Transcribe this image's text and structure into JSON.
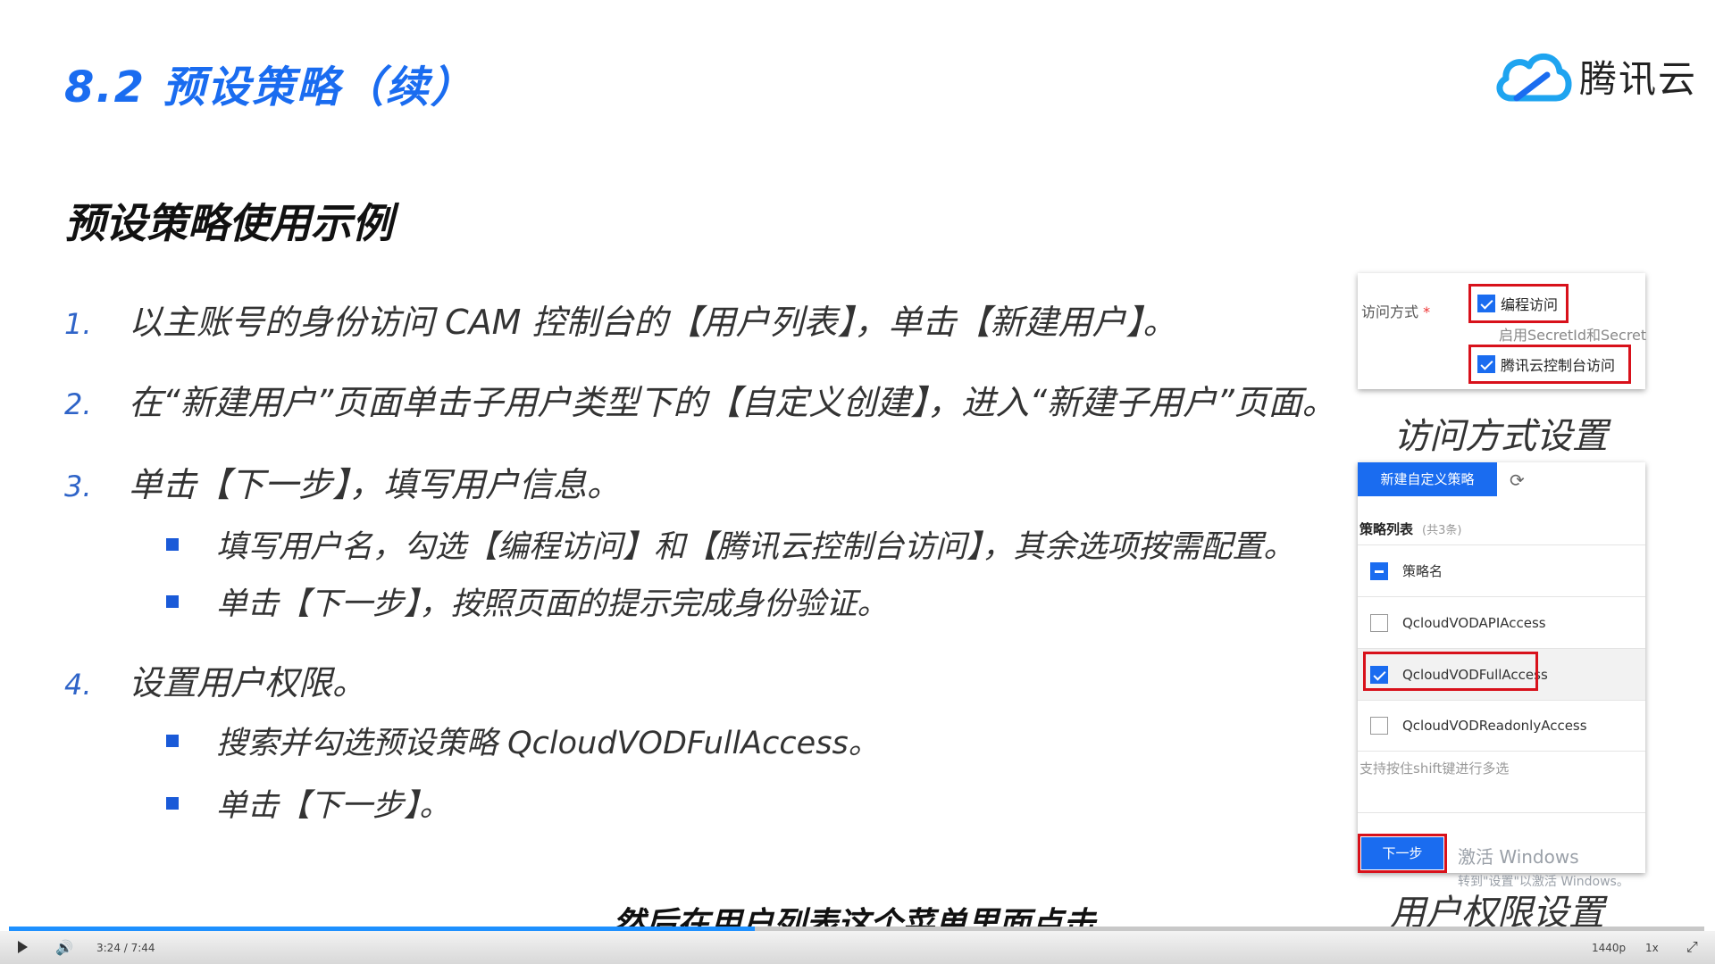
{
  "slide": {
    "title": "8.2 预设策略（续）",
    "logo_text": "腾讯云",
    "subtitle": "预设策略使用示例",
    "steps": [
      {
        "num": "1.",
        "text": "以主账号的身份访问 CAM 控制台的【用户列表】，单击【新建用户】。"
      },
      {
        "num": "2.",
        "text": "在“新建用户”页面单击子用户类型下的【自定义创建】，进入“新建子用户”页面。"
      },
      {
        "num": "3.",
        "text": "单击【下一步】，填写用户信息。"
      },
      {
        "num": "4.",
        "text": "设置用户权限。"
      }
    ],
    "substeps": [
      "填写用户名，勾选【编程访问】和【腾讯云控制台访问】，其余选项按需配置。",
      "单击【下一步】，按照页面的提示完成身份验证。",
      "搜索并勾选预设策略 QcloudVODFullAccess。",
      "单击【下一步】。"
    ]
  },
  "panel_access": {
    "label": "访问方式",
    "required_mark": "*",
    "option1": "编程访问",
    "hint": "启用SecretId和Secret",
    "option2": "腾讯云控制台访问",
    "caption": "访问方式设置"
  },
  "panel_policy": {
    "new_button": "新建自定义策略",
    "list_title": "策略列表",
    "list_count": "(共3条)",
    "header": "策略名",
    "rows": [
      "QcloudVODAPIAccess",
      "QcloudVODFullAccess",
      "QcloudVODReadonlyAccess"
    ],
    "support_hint": "支持按住shift键进行多选",
    "next_button": "下一步",
    "caption": "用户权限设置"
  },
  "watermark": {
    "line1": "激活 Windows",
    "line2": "转到\"设置\"以激活 Windows。"
  },
  "video_subtitle": "然后在用户列表这个菜单里面点击",
  "player": {
    "time": "3:24 / 7:44",
    "progress": 0.44,
    "quality": "1440p",
    "speed": "1x",
    "colors": {
      "accent": "#1e90ff"
    }
  },
  "icons": [
    "tencent-cloud-logo-icon",
    "refresh-icon",
    "play-icon",
    "volume-icon",
    "fullscreen-icon"
  ]
}
